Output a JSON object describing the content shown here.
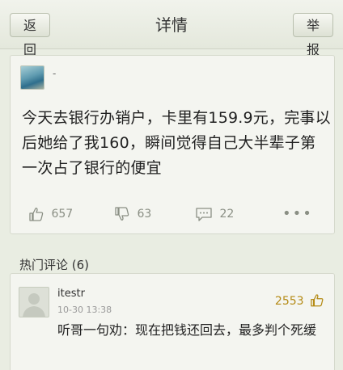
{
  "header": {
    "back_label": "返回",
    "title": "详情",
    "report_label": "举报"
  },
  "post": {
    "author": "-",
    "text": "今天去银行办销户，卡里有159.9元，完事以后她给了我160，瞬间觉得自己大半辈子第一次占了银行的便宜",
    "likes": "657",
    "dislikes": "63",
    "comments": "22",
    "more": "•••"
  },
  "hot_comments": {
    "title": "热门评论 (6)",
    "items": [
      {
        "user": "itestr",
        "time": "10-30 13:38",
        "likes": "2553",
        "text": "听哥一句劝：现在把钱还回去，最多判个死缓"
      }
    ]
  },
  "icons": {
    "like": "thumbs-up-icon",
    "dislike": "thumbs-down-icon",
    "comment": "comment-bubble-icon",
    "more": "more-dots-icon"
  }
}
